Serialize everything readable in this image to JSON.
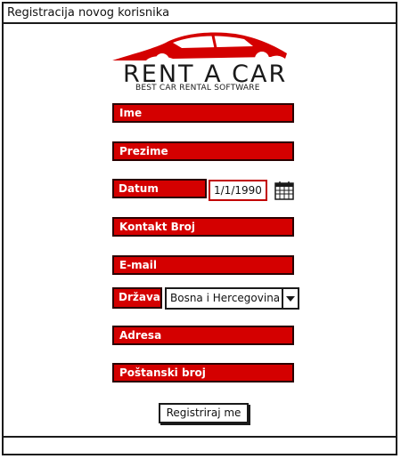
{
  "window": {
    "title": "Registracija novog korisnika"
  },
  "logo": {
    "title": "RENT A CAR",
    "subtitle": "BEST CAR RENTAL SOFTWARE"
  },
  "form": {
    "first_name_label": "Ime",
    "last_name_label": "Prezime",
    "dob_label": "Datum rođenja",
    "dob_value": "1/1/1990",
    "contact_label": "Kontakt Broj",
    "email_label": "E-mail",
    "country_label": "Država",
    "country_value": "Bosna i Hercegovina",
    "address_label": "Adresa",
    "postal_label": "Poštanski broj",
    "submit_label": "Registriraj me"
  },
  "colors": {
    "accent": "#d40000",
    "border": "#1a1a1a"
  },
  "icons": {
    "calendar": "calendar-icon",
    "dropdown": "chevron-down-icon"
  }
}
